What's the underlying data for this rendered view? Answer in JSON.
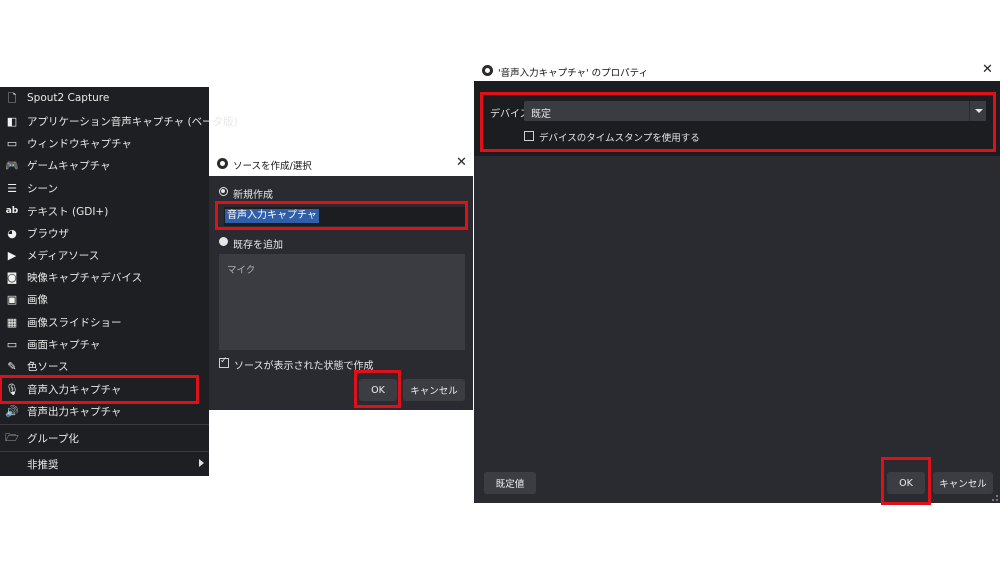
{
  "menu": {
    "items": [
      {
        "icon": "file-icon",
        "glyph": "🗋",
        "label": "Spout2 Capture"
      },
      {
        "icon": "app-audio-icon",
        "glyph": "◧",
        "label": "アプリケーション音声キャプチャ (ベータ版)"
      },
      {
        "icon": "window-icon",
        "glyph": "▭",
        "label": "ウィンドウキャプチャ"
      },
      {
        "icon": "gamepad-icon",
        "glyph": "🎮",
        "label": "ゲームキャプチャ"
      },
      {
        "icon": "list-icon",
        "glyph": "☰",
        "label": "シーン"
      },
      {
        "icon": "text-icon",
        "glyph": "ab",
        "label": "テキスト (GDI+)"
      },
      {
        "icon": "globe-icon",
        "glyph": "◕",
        "label": "ブラウザ"
      },
      {
        "icon": "play-icon",
        "glyph": "▶",
        "label": "メディアソース"
      },
      {
        "icon": "camera-icon",
        "glyph": "◙",
        "label": "映像キャプチャデバイス"
      },
      {
        "icon": "image-icon",
        "glyph": "▣",
        "label": "画像"
      },
      {
        "icon": "slideshow-icon",
        "glyph": "▦",
        "label": "画像スライドショー"
      },
      {
        "icon": "monitor-icon",
        "glyph": "▭",
        "label": "画面キャプチャ"
      },
      {
        "icon": "brush-icon",
        "glyph": "✎",
        "label": "色ソース"
      },
      {
        "icon": "microphone-icon",
        "glyph": "🎙",
        "label": "音声入力キャプチャ"
      },
      {
        "icon": "speaker-icon",
        "glyph": "🔊",
        "label": "音声出力キャプチャ"
      },
      {
        "icon": "folder-icon",
        "glyph": "🗁",
        "label": "グループ化"
      },
      {
        "icon": "",
        "glyph": "",
        "label": "非推奨"
      }
    ]
  },
  "create_dialog": {
    "title": "ソースを作成/選択",
    "close": "✕",
    "new_label": "新規作成",
    "name_value": "音声入力キャプチャ",
    "existing_label": "既存を追加",
    "existing_items": [
      "マイク"
    ],
    "visible_checkbox": "ソースが表示された状態で作成",
    "ok": "OK",
    "cancel": "キャンセル"
  },
  "properties_dialog": {
    "title": "'音声入力キャプチャ' のプロパティ",
    "close": "✕",
    "device_label": "デバイス",
    "device_value": "既定",
    "timestamp_checkbox": "デバイスのタイムスタンプを使用する",
    "defaults": "既定値",
    "ok": "OK",
    "cancel": "キャンセル"
  },
  "colors": {
    "highlight": "#e0101a",
    "dark_bg": "#1e1f22",
    "panel_bg": "#2a2b30",
    "selection": "#2f5fa8"
  }
}
